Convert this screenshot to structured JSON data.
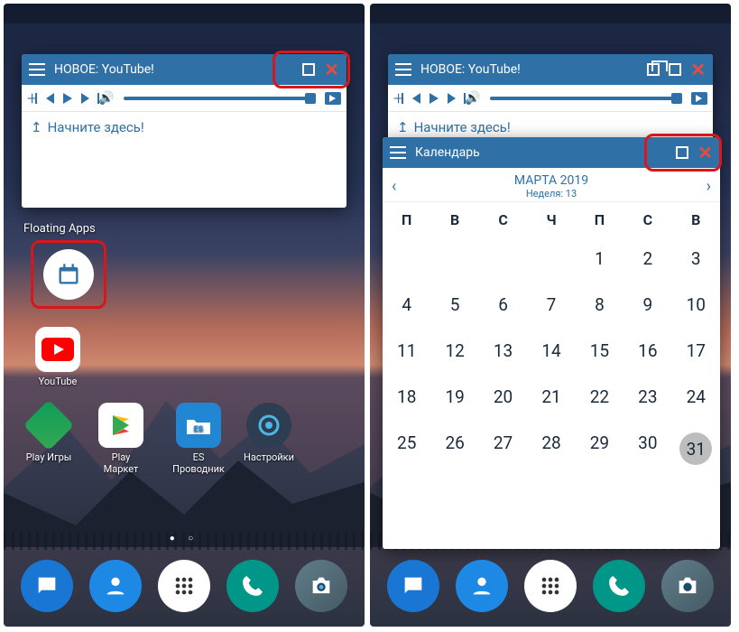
{
  "left": {
    "youtube_window": {
      "title": "НОВОЕ: YouTube!",
      "placeholder": "Начните здесь!"
    },
    "section_label": "Floating Apps",
    "apps": {
      "youtube": "YouTube",
      "play_games": "Play Игры",
      "play_market": "Play Маркет",
      "es_explorer": "ES Проводник",
      "settings": "Настройки"
    }
  },
  "right": {
    "youtube_window": {
      "title": "НОВОЕ: YouTube!",
      "placeholder": "Начните здесь!"
    },
    "calendar_window": {
      "title": "Календарь",
      "month": "МАРТА 2019",
      "week": "Неделя: 13",
      "day_headers": [
        "П",
        "В",
        "С",
        "Ч",
        "П",
        "С",
        "В"
      ],
      "weeks": [
        [
          "",
          "",
          "",
          "",
          "1",
          "2",
          "3"
        ],
        [
          "4",
          "5",
          "6",
          "7",
          "8",
          "9",
          "10"
        ],
        [
          "11",
          "12",
          "13",
          "14",
          "15",
          "16",
          "17"
        ],
        [
          "18",
          "19",
          "20",
          "21",
          "22",
          "23",
          "24"
        ],
        [
          "25",
          "26",
          "27",
          "28",
          "29",
          "30",
          "31"
        ]
      ],
      "today": "31"
    }
  }
}
